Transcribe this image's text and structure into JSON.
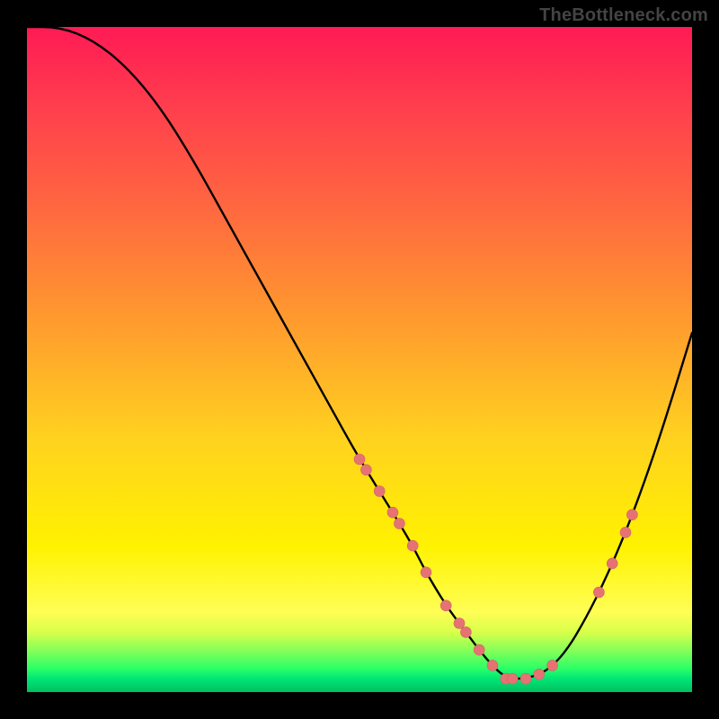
{
  "watermark": "TheBottleneck.com",
  "colors": {
    "curve": "#000000",
    "marker_fill": "#e57373",
    "marker_stroke": "#d26363",
    "gradient_top": "#ff1a55",
    "gradient_mid1": "#ff9a2e",
    "gradient_mid2": "#fff200",
    "gradient_bottom": "#00c060",
    "frame": "#000000"
  },
  "chart_data": {
    "type": "line",
    "title": "",
    "xlabel": "",
    "ylabel": "",
    "xlim": [
      0,
      100
    ],
    "ylim": [
      0,
      100
    ],
    "grid": false,
    "legend": null,
    "description": "Single black V-shaped curve over a red→yellow→green vertical gradient. Minimum (best / bottleneck-free region) near x≈72, y≈2. Salmon dot clusters highlight segments of the curve on the descent, along the trough, and on the ascent.",
    "series": [
      {
        "name": "bottleneck-curve",
        "x": [
          0,
          5,
          10,
          15,
          20,
          25,
          30,
          35,
          40,
          45,
          50,
          55,
          58,
          60,
          63,
          66,
          69,
          72,
          75,
          78,
          81,
          84,
          87,
          90,
          93,
          96,
          100
        ],
        "y": [
          100,
          100,
          98,
          94,
          88,
          80,
          71,
          62,
          53,
          44,
          35,
          27,
          22,
          18,
          13,
          9,
          5,
          2,
          2,
          3,
          6,
          11,
          17,
          24,
          32,
          41,
          54
        ]
      }
    ],
    "markers": {
      "left_cluster_x": [
        50,
        51,
        53,
        55,
        56,
        58,
        60
      ],
      "bottom_cluster_x": [
        63,
        65,
        66,
        68,
        70,
        72,
        73,
        75,
        77,
        79
      ],
      "right_cluster_x": [
        86,
        88,
        90,
        91
      ]
    },
    "marker_radius": 6
  }
}
